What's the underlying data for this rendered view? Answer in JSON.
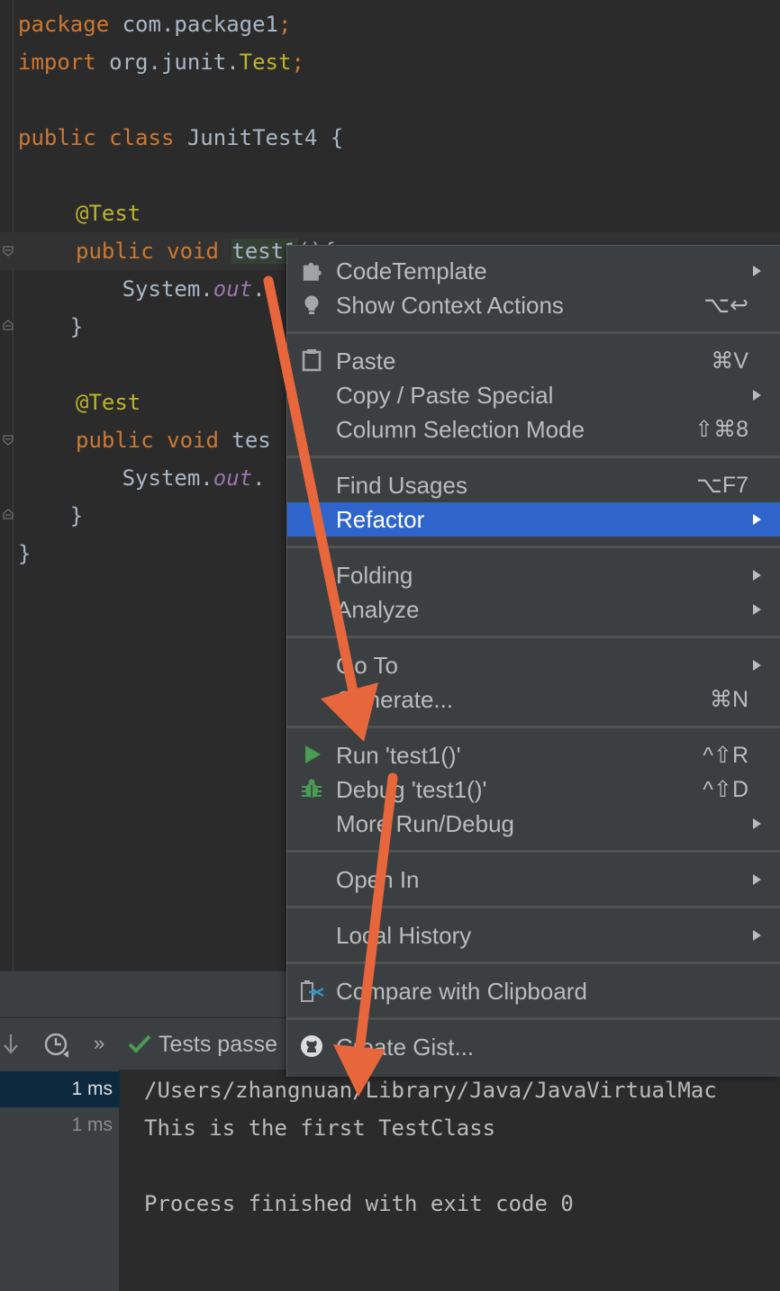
{
  "editor": {
    "lines": {
      "l1_kw": "package",
      "l1_rest": " com.package1",
      "l1_semi": ";",
      "l2_kw": "import",
      "l2_rest": " org.junit.",
      "l2_test": "Test",
      "l2_semi": ";",
      "l4_kw": "public class",
      "l4_rest": " JunitTest4 {",
      "l6_ann": "@Test",
      "l7_kw": "public void",
      "l7_sp": " ",
      "l7_name": "test1",
      "l7_rest": "(){",
      "l8_pre": "        System.",
      "l8_field": "out",
      "l8_rest": ".",
      "l9": "    }",
      "l11_ann": "@Test",
      "l12_kw": "public void",
      "l12_rest": " tes",
      "l13_pre": "        System.",
      "l13_field": "out",
      "l13_rest": ".",
      "l14": "    }",
      "l15": "}"
    }
  },
  "context_menu": {
    "items": [
      {
        "label": "CodeTemplate",
        "icon": "puzzle-icon",
        "submenu": true
      },
      {
        "label": "Show Context Actions",
        "icon": "bulb-icon",
        "shortcut": "⌥↩"
      },
      {
        "label": "Paste",
        "icon": "clipboard-icon",
        "shortcut": "⌘V"
      },
      {
        "label": "Copy / Paste Special",
        "submenu": true
      },
      {
        "label": "Column Selection Mode",
        "shortcut": "⇧⌘8"
      },
      {
        "label": "Find Usages",
        "shortcut": "⌥F7"
      },
      {
        "label": "Refactor",
        "submenu": true,
        "highlighted": true
      },
      {
        "label": "Folding",
        "submenu": true
      },
      {
        "label": "Analyze",
        "submenu": true
      },
      {
        "label": "Go To",
        "submenu": true
      },
      {
        "label": "Generate...",
        "shortcut": "⌘N"
      },
      {
        "label": "Run 'test1()'",
        "icon": "run-icon",
        "shortcut": "^⇧R"
      },
      {
        "label": "Debug 'test1()'",
        "icon": "debug-icon",
        "shortcut": "^⇧D"
      },
      {
        "label": "More Run/Debug",
        "submenu": true
      },
      {
        "label": "Open In",
        "submenu": true
      },
      {
        "label": "Local History",
        "submenu": true
      },
      {
        "label": "Compare with Clipboard",
        "icon": "compare-icon"
      },
      {
        "label": "Create Gist...",
        "icon": "github-icon"
      }
    ]
  },
  "run_panel": {
    "chevrons": "»",
    "status": "Tests passe",
    "tree": [
      {
        "time": "1 ms",
        "selected": true
      },
      {
        "time": "1 ms",
        "selected": false
      }
    ],
    "console": [
      "/Users/zhangnuan/Library/Java/JavaVirtualMac",
      "This is the first TestClass",
      "",
      "Process finished with exit code 0"
    ]
  },
  "colors": {
    "highlight": "#2f65ca",
    "annotation_arrow": "#e8663c",
    "run_green": "#499c54"
  }
}
